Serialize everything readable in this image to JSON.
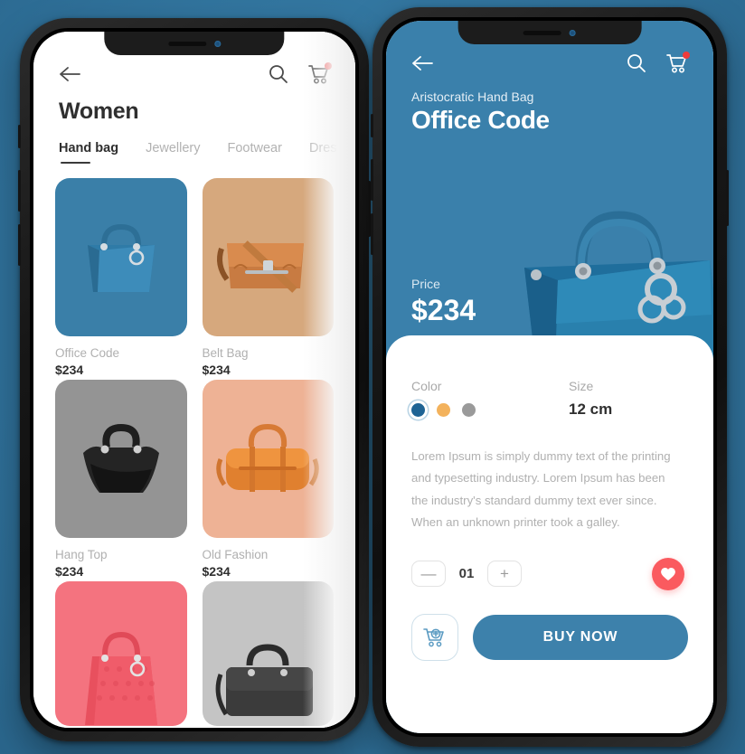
{
  "theme": {
    "page_background": "#2f7099",
    "accent_blue": "#3a80ab",
    "button_blue": "#3d81ab",
    "favorite_red": "#fa5a5f",
    "badge_red": "#ef3b3b"
  },
  "left_phone": {
    "topbar": {
      "back_icon": "arrow-left-icon",
      "search_icon": "search-icon",
      "cart_icon": "cart-icon",
      "cart_badge": ""
    },
    "page_title": "Women",
    "tabs": [
      {
        "label": "Hand bag",
        "active": true
      },
      {
        "label": "Jewellery",
        "active": false
      },
      {
        "label": "Footwear",
        "active": false
      },
      {
        "label": "Dres",
        "active": false
      }
    ],
    "products": [
      {
        "name": "Office Code",
        "price": "$234",
        "card_color": "#3a7fa8",
        "bag": "blue-tote"
      },
      {
        "name": "Belt Bag",
        "price": "$234",
        "card_color": "#d6a87d",
        "bag": "tan-satchel"
      },
      {
        "name": "Hang Top",
        "price": "$234",
        "card_color": "#949494",
        "bag": "black-hobo"
      },
      {
        "name": "Old Fashion",
        "price": "$234",
        "card_color": "#eeb295",
        "bag": "orange-duffle"
      },
      {
        "name": "",
        "price": "",
        "card_color": "#f4737f",
        "bag": "pink-quilted"
      },
      {
        "name": "",
        "price": "",
        "card_color": "#c4c4c4",
        "bag": "gray-briefcase"
      }
    ]
  },
  "right_phone": {
    "topbar": {
      "back_icon": "arrow-left-icon",
      "search_icon": "search-icon",
      "cart_icon": "cart-icon",
      "cart_badge": ""
    },
    "subtitle": "Aristocratic Hand Bag",
    "title": "Office Code",
    "price_label": "Price",
    "price": "$234",
    "color_label": "Color",
    "colors": [
      {
        "name": "blue",
        "hex": "#1e6394",
        "selected": true
      },
      {
        "name": "orange",
        "hex": "#f3b25c",
        "selected": false
      },
      {
        "name": "gray",
        "hex": "#9a9a9a",
        "selected": false
      }
    ],
    "size_label": "Size",
    "size_value": "12 cm",
    "description": "Lorem Ipsum is simply dummy text of the printing and typesetting industry. Lorem Ipsum has been the industry's standard dummy text ever since. When an unknown printer took a galley.",
    "quantity": {
      "decrement_label": "—",
      "value": "01",
      "increment_label": "+"
    },
    "favorite_icon": "heart-icon",
    "add_to_cart_icon": "cart-plus-icon",
    "buy_button_label": "BUY NOW"
  }
}
